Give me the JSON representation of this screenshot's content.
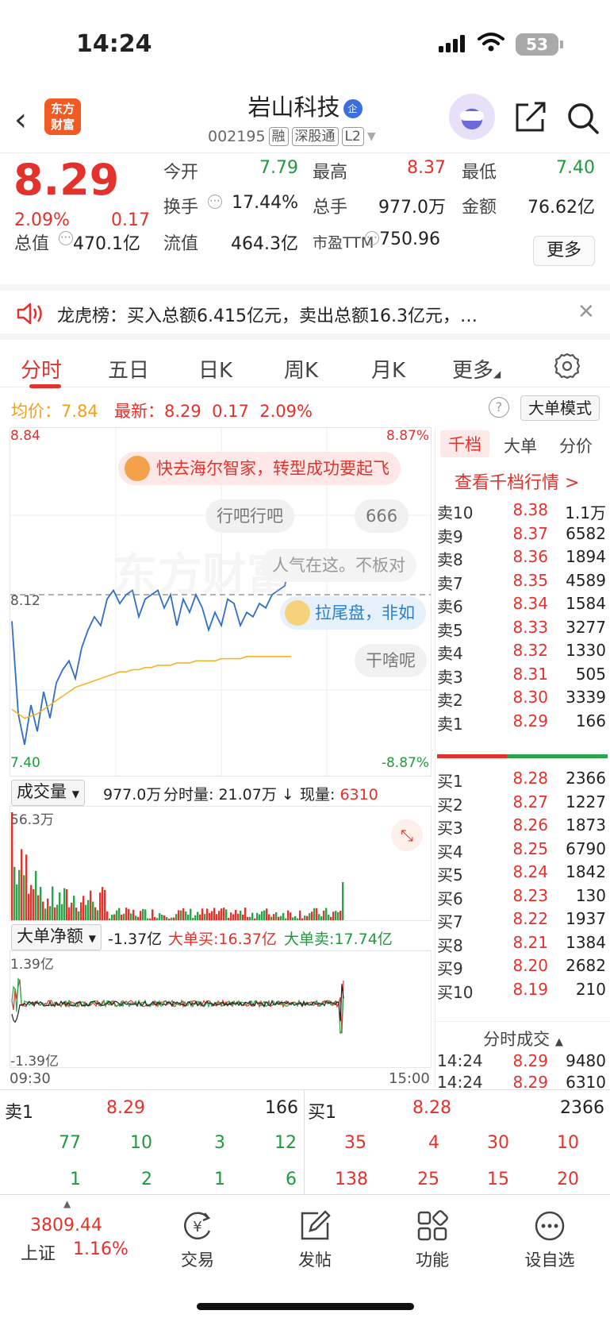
{
  "status": {
    "time": "14:24",
    "battery": "53"
  },
  "header": {
    "logo_line1": "东方",
    "logo_line2": "财富",
    "stock_name": "岩山科技",
    "stock_badge": "企",
    "code": "002195",
    "tags": [
      "融",
      "深股通",
      "L2"
    ]
  },
  "quote": {
    "price": "8.29",
    "change_pct": "2.09%",
    "change": "0.17",
    "fields": [
      {
        "label": "今开",
        "value": "7.79",
        "color": "green"
      },
      {
        "label": "最高",
        "value": "8.37",
        "color": "red"
      },
      {
        "label": "最低",
        "value": "7.40",
        "color": "green"
      },
      {
        "label": "换手",
        "value": "17.44%",
        "color": "plain"
      },
      {
        "label": "总手",
        "value": "977.0万",
        "color": "plain"
      },
      {
        "label": "金额",
        "value": "76.62亿",
        "color": "plain"
      },
      {
        "label": "总值",
        "value": "470.1亿",
        "color": "plain"
      },
      {
        "label": "流值",
        "value": "464.3亿",
        "color": "plain"
      },
      {
        "label": "市盈TTM",
        "value": "750.96",
        "color": "plain"
      }
    ],
    "more_button": "更多"
  },
  "notice": {
    "text": "龙虎榜：买入总额6.415亿元，卖出总额16.3亿元，…"
  },
  "tabs": [
    "分时",
    "五日",
    "日K",
    "周K",
    "月K",
    "更多"
  ],
  "info": {
    "avg_label": "均价：",
    "avg_value": "7.84",
    "latest_label": "最新：",
    "latest_value": "8.29",
    "latest_change": "0.17",
    "latest_pct": "2.09%",
    "mode_button": "大单模式"
  },
  "chart": {
    "y_top": "8.84",
    "y_top_pct": "8.87%",
    "y_mid": "8.12",
    "y_bottom": "7.40",
    "y_bottom_pct": "-8.87%",
    "bubbles": [
      "快去海尔智家，转型成功要起飞",
      "行吧行吧",
      "666",
      "人气在这。不板对",
      "拉尾盘，非如",
      "干啥呢"
    ],
    "watermark": "东方财富"
  },
  "chart_data": {
    "type": "line",
    "title": "",
    "xlabel": "",
    "ylabel": "",
    "x_range": [
      "09:30",
      "15:00"
    ],
    "ylim": [
      7.4,
      8.84
    ],
    "reference_line": 8.12,
    "series": [
      {
        "values": [
          8.0,
          7.58,
          7.44,
          7.62,
          7.5,
          7.68,
          7.56,
          7.72,
          7.78,
          7.82,
          7.74,
          7.88,
          7.96,
          8.02,
          7.98,
          8.1,
          8.14,
          8.08,
          8.12,
          8.14,
          8.02,
          8.1,
          8.12,
          8.14,
          8.06,
          8.12,
          7.98,
          8.1,
          8.04,
          8.12,
          8.06,
          7.96,
          8.04,
          7.98,
          8.1,
          8.08,
          7.98,
          8.04,
          8.02,
          8.08,
          8.06,
          8.12,
          8.14,
          8.16,
          8.29
        ]
      },
      {
        "values": [
          7.6,
          7.58,
          7.56,
          7.57,
          7.58,
          7.6,
          7.62,
          7.64,
          7.66,
          7.68,
          7.7,
          7.71,
          7.72,
          7.73,
          7.74,
          7.75,
          7.76,
          7.77,
          7.77,
          7.78,
          7.78,
          7.79,
          7.79,
          7.8,
          7.8,
          7.8,
          7.81,
          7.81,
          7.81,
          7.82,
          7.82,
          7.82,
          7.82,
          7.83,
          7.83,
          7.83,
          7.83,
          7.84,
          7.84,
          7.84,
          7.84,
          7.84,
          7.84,
          7.84,
          7.84
        ]
      }
    ]
  },
  "volume": {
    "select": "成交量",
    "total": "977.0万",
    "period_label": "分时量:",
    "period_value": "21.07万",
    "now_label": "现量:",
    "now_value": "6310",
    "max_label": "56.3万"
  },
  "net": {
    "select": "大单净额",
    "value": "-1.37亿",
    "buy_label": "大单买:",
    "buy_value": "16.37亿",
    "sell_label": "大单卖:",
    "sell_value": "17.74亿",
    "top": "1.39亿",
    "bottom": "-1.39亿"
  },
  "time_axis": {
    "start": "09:30",
    "end": "15:00"
  },
  "book": {
    "tabs": [
      "千档",
      "大单",
      "分价"
    ],
    "link": "查看千档行情 >",
    "asks": [
      {
        "label": "卖10",
        "price": "8.38",
        "vol": "1.1万"
      },
      {
        "label": "卖9",
        "price": "8.37",
        "vol": "6582"
      },
      {
        "label": "卖8",
        "price": "8.36",
        "vol": "1894"
      },
      {
        "label": "卖7",
        "price": "8.35",
        "vol": "4589"
      },
      {
        "label": "卖6",
        "price": "8.34",
        "vol": "1584"
      },
      {
        "label": "卖5",
        "price": "8.33",
        "vol": "3277"
      },
      {
        "label": "卖4",
        "price": "8.32",
        "vol": "1330"
      },
      {
        "label": "卖3",
        "price": "8.31",
        "vol": "505"
      },
      {
        "label": "卖2",
        "price": "8.30",
        "vol": "3339"
      },
      {
        "label": "卖1",
        "price": "8.29",
        "vol": "166"
      }
    ],
    "bids": [
      {
        "label": "买1",
        "price": "8.28",
        "vol": "2366"
      },
      {
        "label": "买2",
        "price": "8.27",
        "vol": "1227"
      },
      {
        "label": "买3",
        "price": "8.26",
        "vol": "1873"
      },
      {
        "label": "买4",
        "price": "8.25",
        "vol": "6790"
      },
      {
        "label": "买5",
        "price": "8.24",
        "vol": "1842"
      },
      {
        "label": "买6",
        "price": "8.23",
        "vol": "130"
      },
      {
        "label": "买7",
        "price": "8.22",
        "vol": "1937"
      },
      {
        "label": "买8",
        "price": "8.21",
        "vol": "1384"
      },
      {
        "label": "买9",
        "price": "8.20",
        "vol": "2682"
      },
      {
        "label": "买10",
        "price": "8.19",
        "vol": "210"
      }
    ],
    "trades_title": "分时成交",
    "trades": [
      {
        "time": "14:24",
        "price": "8.29",
        "vol": "9480"
      },
      {
        "time": "14:24",
        "price": "8.29",
        "vol": "6310"
      }
    ]
  },
  "summary": {
    "ask_label": "卖1",
    "ask_price": "8.29",
    "ask_vol": "166",
    "bid_label": "买1",
    "bid_price": "8.28",
    "bid_vol": "2366",
    "ask_queue_row1": [
      "77",
      "10",
      "3",
      "12"
    ],
    "ask_queue_row2": [
      "1",
      "2",
      "1",
      "6"
    ],
    "bid_queue_row1": [
      "35",
      "4",
      "30",
      "10"
    ],
    "bid_queue_row2": [
      "138",
      "25",
      "15",
      "20"
    ]
  },
  "bottom_nav": {
    "index_value": "3809.44",
    "index_name": "上证",
    "index_pct": "1.16%",
    "items": [
      "交易",
      "发帖",
      "功能",
      "设自选"
    ]
  }
}
